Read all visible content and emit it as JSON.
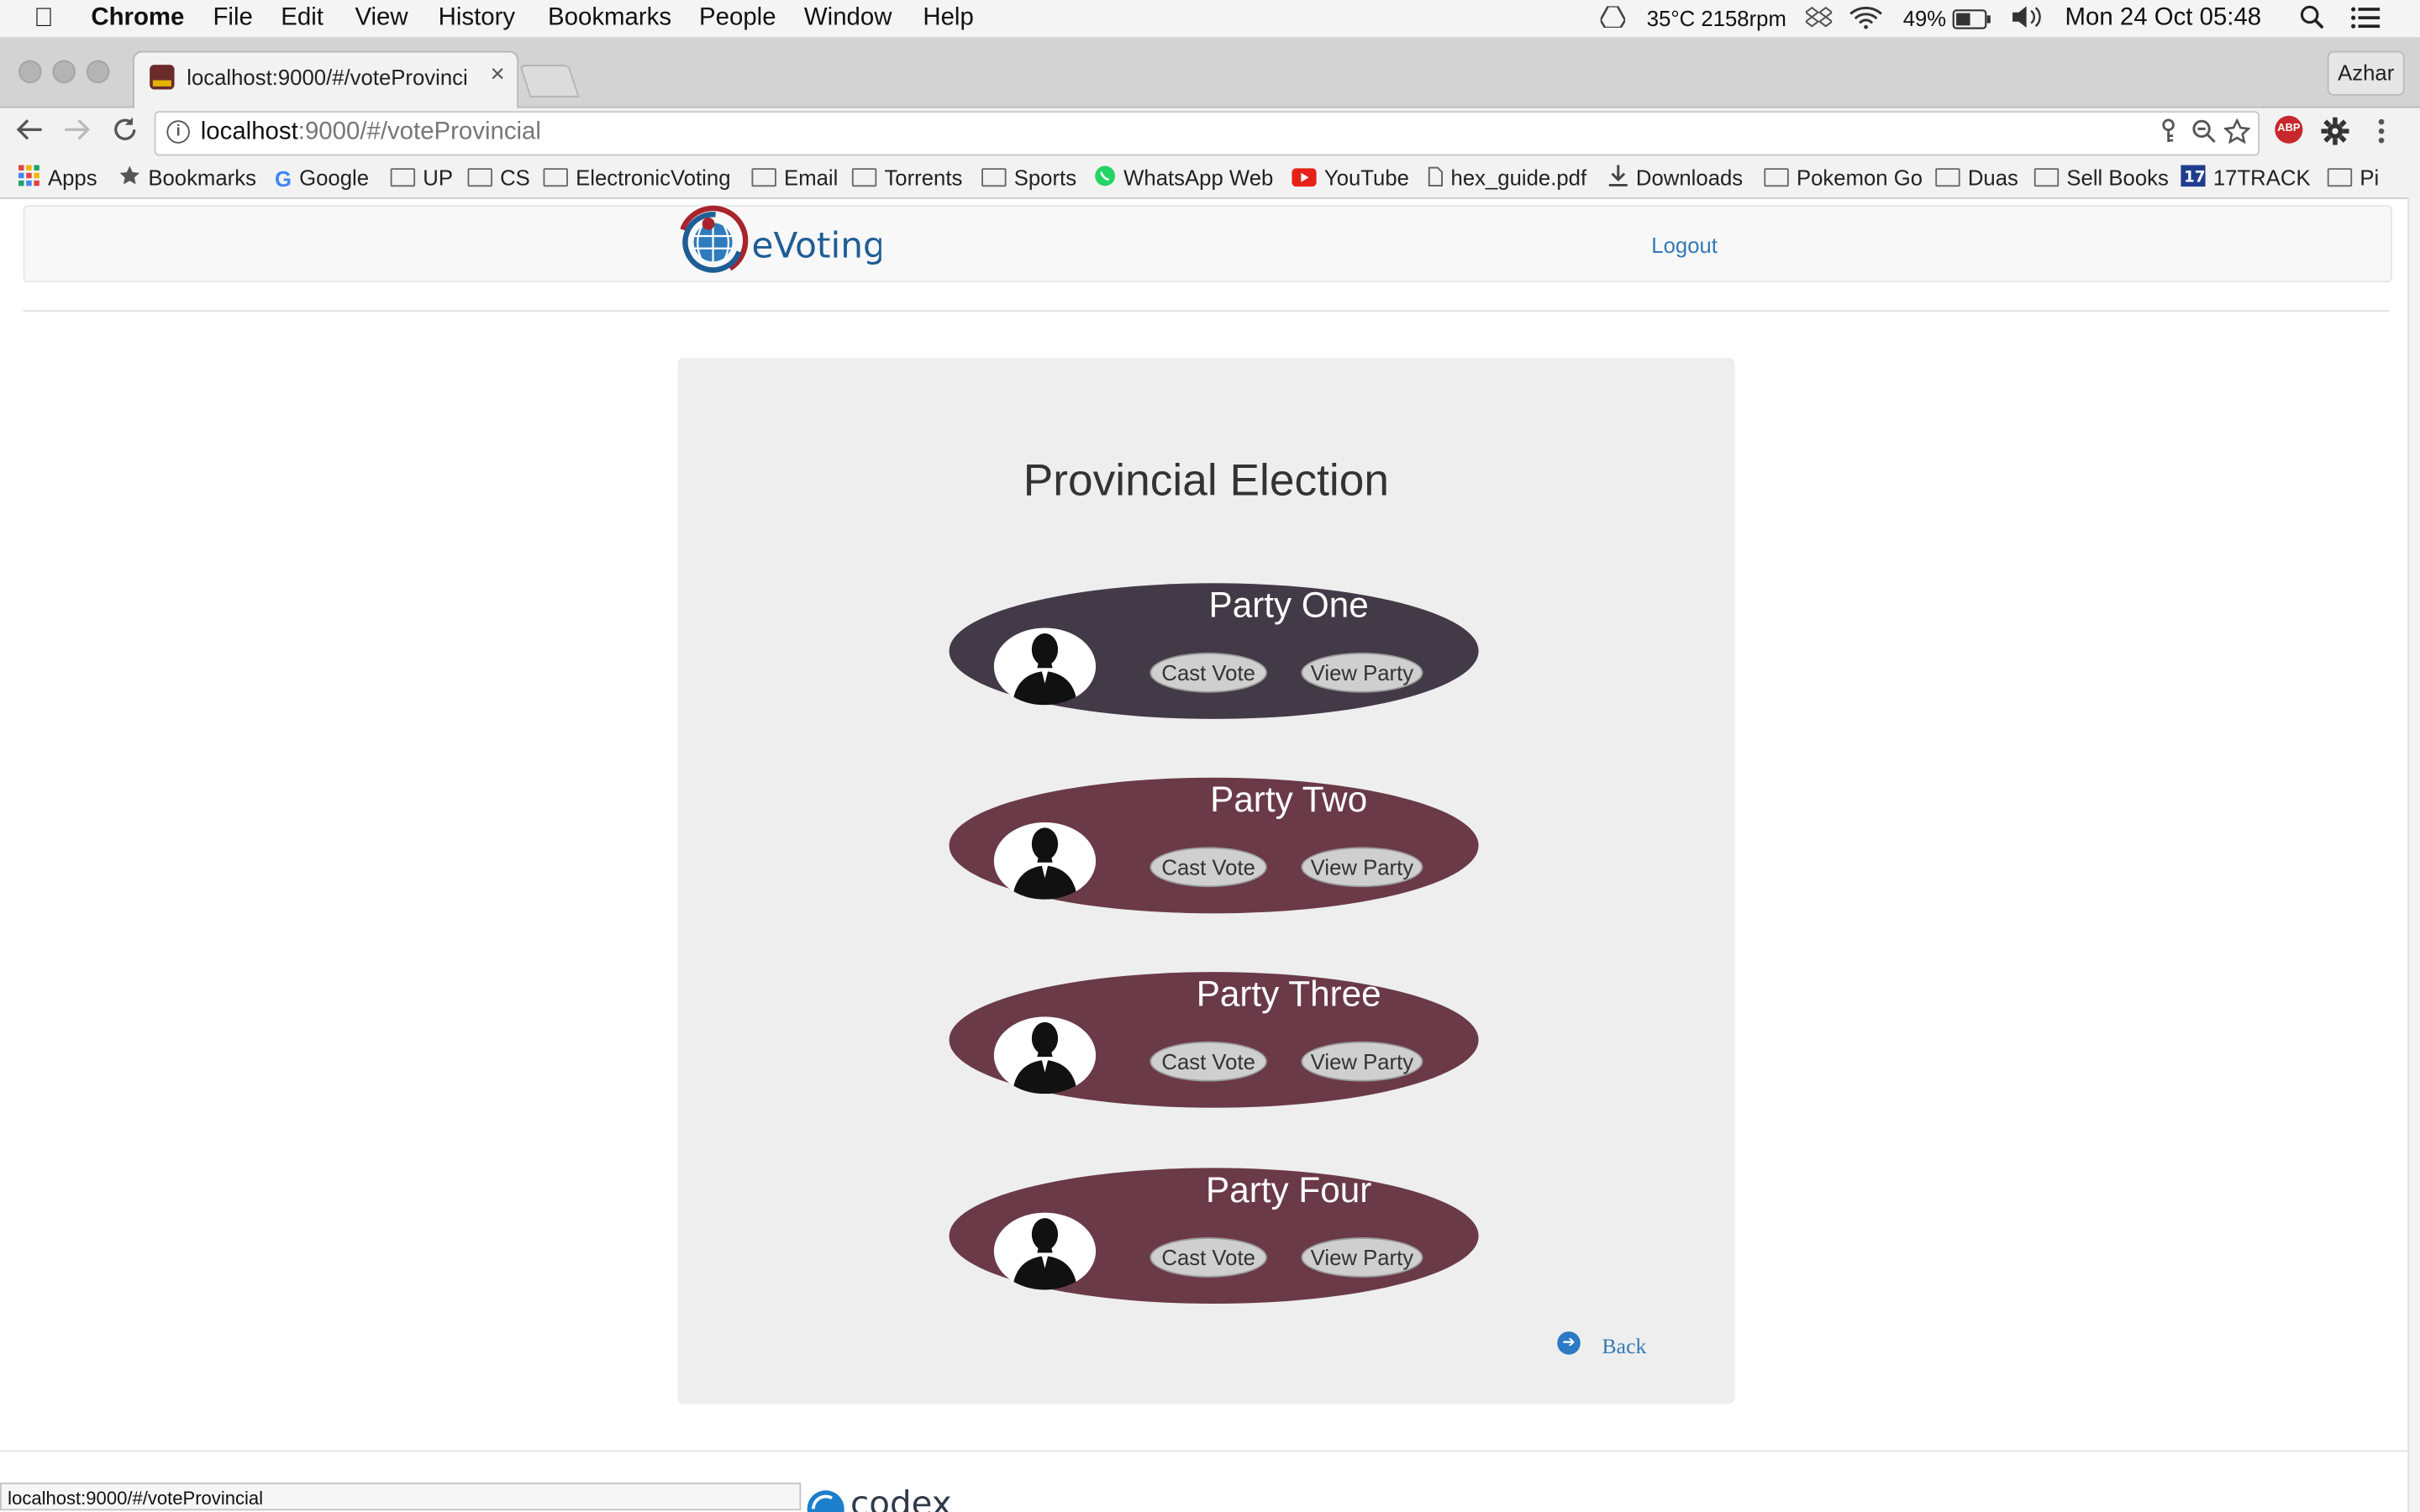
{
  "menubar": {
    "app": "Chrome",
    "items": [
      "File",
      "Edit",
      "View",
      "History",
      "Bookmarks",
      "People",
      "Window",
      "Help"
    ],
    "status": {
      "temp_fan": "35°C 2158rpm",
      "battery": "49%",
      "datetime": "Mon 24 Oct  05:48"
    }
  },
  "browser": {
    "tab_title": "localhost:9000/#/voteProvinci",
    "profile": "Azhar",
    "url_host": "localhost",
    "url_rest": ":9000/#/voteProvincial",
    "status_url": "localhost:9000/#/voteProvincial"
  },
  "bookmarks": [
    "Apps",
    "Bookmarks",
    "Google",
    "UP",
    "CS",
    "ElectronicVoting",
    "Email",
    "Torrents",
    "Sports",
    "WhatsApp Web",
    "YouTube",
    "hex_guide.pdf",
    "Downloads",
    "Pokemon Go",
    "Duas",
    "Sell Books",
    "17TRACK",
    "Pi"
  ],
  "page": {
    "brand": "eVoting",
    "logout": "Logout",
    "title": "Provincial Election",
    "back": "Back",
    "footer_logo": "codex",
    "parties": [
      {
        "name": "Party One",
        "cast": "Cast Vote",
        "view": "View Party",
        "color": "#433a47"
      },
      {
        "name": "Party Two",
        "cast": "Cast Vote",
        "view": "View Party",
        "color": "#6a3a48"
      },
      {
        "name": "Party Three",
        "cast": "Cast Vote",
        "view": "View Party",
        "color": "#6a3a48"
      },
      {
        "name": "Party Four",
        "cast": "Cast Vote",
        "view": "View Party",
        "color": "#6a3a48"
      }
    ]
  },
  "colors": {
    "link": "#337ab7",
    "panel": "#eeeeee",
    "party_selected": "#433a47",
    "party_default": "#6a3a48"
  }
}
